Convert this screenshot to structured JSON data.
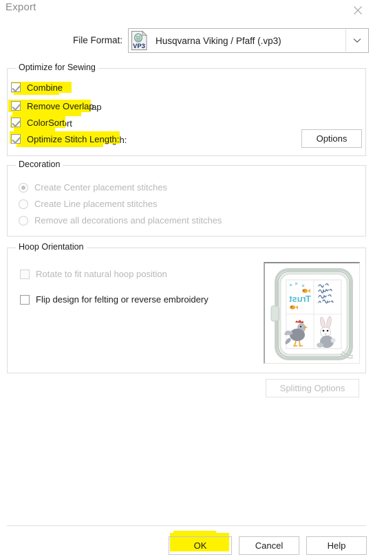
{
  "window": {
    "title": "Export",
    "close_icon": "close-icon"
  },
  "file_format": {
    "label": "File Format:",
    "value": "Husqvarna Viking / Pfaff (.vp3)",
    "icon_name": "vp3-file-icon",
    "icon_text": "VP3",
    "dropdown_icon": "chevron-down-icon"
  },
  "optimize": {
    "title": "Optimize for Sewing",
    "items": [
      {
        "label": "Combine",
        "checked": true,
        "enabled": true,
        "highlighted": true
      },
      {
        "label": "Remove Overlap",
        "checked": true,
        "enabled": true,
        "highlighted": true
      },
      {
        "label": "ColorSort",
        "checked": true,
        "enabled": true,
        "highlighted": true
      },
      {
        "label": "Optimize Stitch Length:",
        "checked": true,
        "enabled": true,
        "highlighted": true
      }
    ],
    "options_button": "Options"
  },
  "decoration": {
    "title": "Decoration",
    "enabled": false,
    "items": [
      {
        "label": "Create Center placement stitches",
        "selected": true
      },
      {
        "label": "Create Line placement stitches",
        "selected": false
      },
      {
        "label": "Remove all decorations and placement stitches",
        "selected": false
      }
    ]
  },
  "hoop": {
    "title": "Hoop Orientation",
    "items": [
      {
        "label": "Rotate to fit natural hoop position",
        "checked": false,
        "enabled": false
      },
      {
        "label": "Flip design for felting or reverse embroidery",
        "checked": false,
        "enabled": true
      }
    ],
    "preview_name": "hoop-design-preview"
  },
  "splitting_button": {
    "label": "Splitting Options",
    "enabled": false
  },
  "footer": {
    "ok": "OK",
    "cancel": "Cancel",
    "help": "Help"
  },
  "colors": {
    "highlight": "#fff200",
    "text": "#1d1d1d",
    "disabled_text": "#b8b8b8",
    "border": "#dcdcdc",
    "title_text": "#8a8a8a"
  }
}
